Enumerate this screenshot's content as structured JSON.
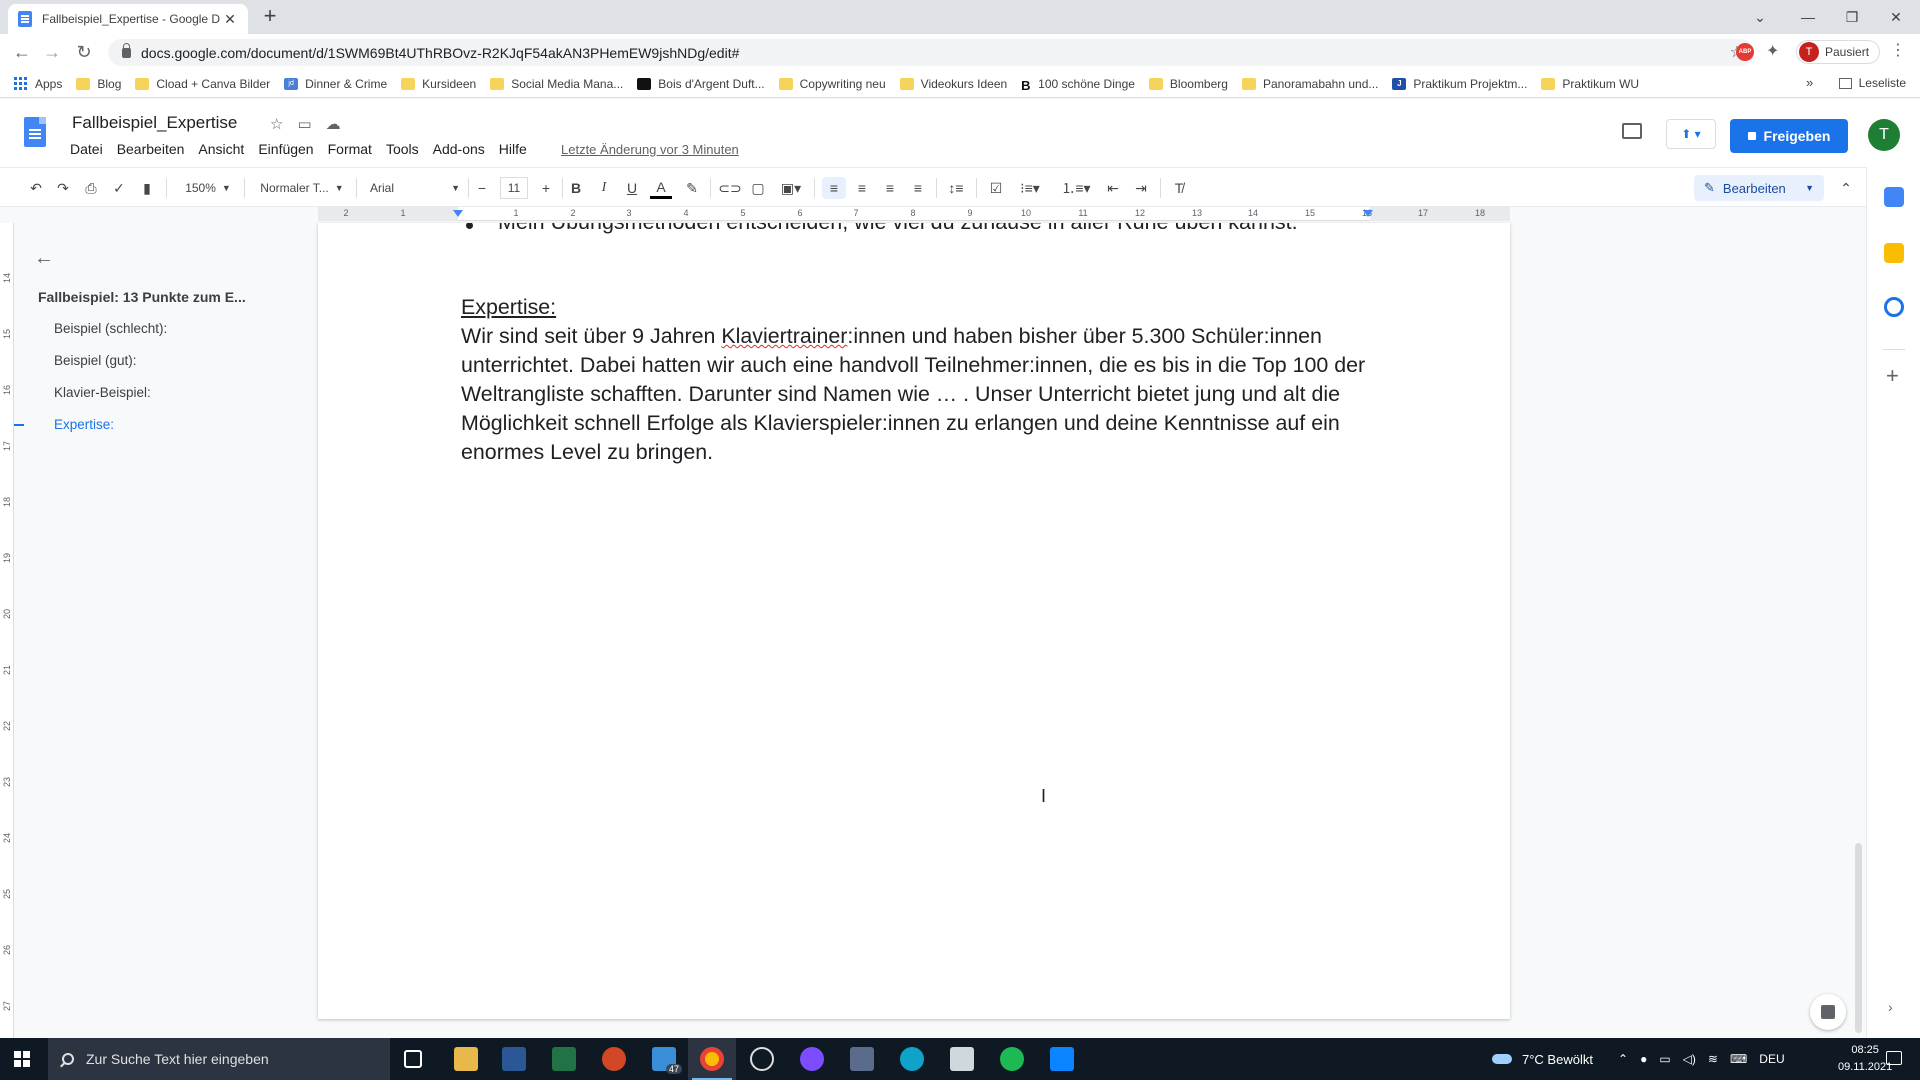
{
  "browser": {
    "tab_title": "Fallbeispiel_Expertise - Google D",
    "url": "docs.google.com/document/d/1SWM69Bt4UThRBOvz-R2KJqF54akAN3PHemEW9jshNDg/edit#",
    "profile_initial": "T",
    "profile_status": "Pausiert",
    "abp_label": "ABP",
    "bookmarks": [
      "Apps",
      "Blog",
      "Cload + Canva Bilder",
      "Dinner & Crime",
      "Kursideen",
      "Social Media Mana...",
      "Bois d'Argent Duft...",
      "Copywriting neu",
      "Videokurs Ideen",
      "100 schöne Dinge",
      "Bloomberg",
      "Panoramabahn und...",
      "Praktikum Projektm...",
      "Praktikum WU"
    ],
    "bookmark_icon_labels": {
      "jd": "jd",
      "b": "B",
      "j": "J"
    },
    "reading_list": "Leseliste",
    "more_bookmarks": "»"
  },
  "docs": {
    "title": "Fallbeispiel_Expertise",
    "menus": [
      "Datei",
      "Bearbeiten",
      "Ansicht",
      "Einfügen",
      "Format",
      "Tools",
      "Add-ons",
      "Hilfe"
    ],
    "last_edit": "Letzte Änderung vor 3 Minuten",
    "share_label": "Freigeben",
    "user_initial": "T"
  },
  "toolbar": {
    "zoom": "150%",
    "style": "Normaler T...",
    "font": "Arial",
    "font_size": "11",
    "mode": "Bearbeiten"
  },
  "ruler": {
    "ticks": [
      "2",
      "1",
      "1",
      "2",
      "3",
      "4",
      "5",
      "6",
      "7",
      "8",
      "9",
      "10",
      "11",
      "12",
      "13",
      "14",
      "15",
      "16",
      "17",
      "18"
    ],
    "vertical_ticks": [
      "14",
      "15",
      "16",
      "17",
      "18",
      "19",
      "20",
      "21",
      "22",
      "23",
      "24",
      "25",
      "26",
      "27"
    ]
  },
  "outline": {
    "heading": "Fallbeispiel: 13 Punkte zum E...",
    "items": [
      "Beispiel (schlecht):",
      "Beispiel (gut):",
      "Klavier-Beispiel:",
      "Expertise:"
    ],
    "active_index": 3
  },
  "document": {
    "bullet_line": "Mein Übungsmethoden entscheiden, wie viel du zuhause in aller Ruhe üben kannst.",
    "heading": "Expertise:",
    "para_before_misspelled": "Wir sind seit über 9 Jahren ",
    "misspelled_word": "Klaviertrainer",
    "para_after_misspelled": ":innen und haben bisher über 5.300 Schüler:innen unterrichtet. Dabei hatten wir auch eine handvoll Teilnehmer:innen, die es bis in die Top 100 der Weltrangliste schafften. Darunter sind Namen wie … . Unser Unterricht bietet jung und alt die Möglichkeit schnell Erfolge als Klavierspieler:innen zu erlangen und deine Kenntnisse auf ein enormes Level zu bringen."
  },
  "taskbar": {
    "search_placeholder": "Zur Suche Text hier eingeben",
    "mail_badge": "47",
    "weather": "7°C  Bewölkt",
    "language": "DEU",
    "time": "08:25",
    "date": "09.11.2021"
  },
  "colors": {
    "accent": "#1a73e8",
    "share_button": "#1a73e8",
    "avatar": "#1e7e34",
    "spell_error": "#d93025"
  }
}
